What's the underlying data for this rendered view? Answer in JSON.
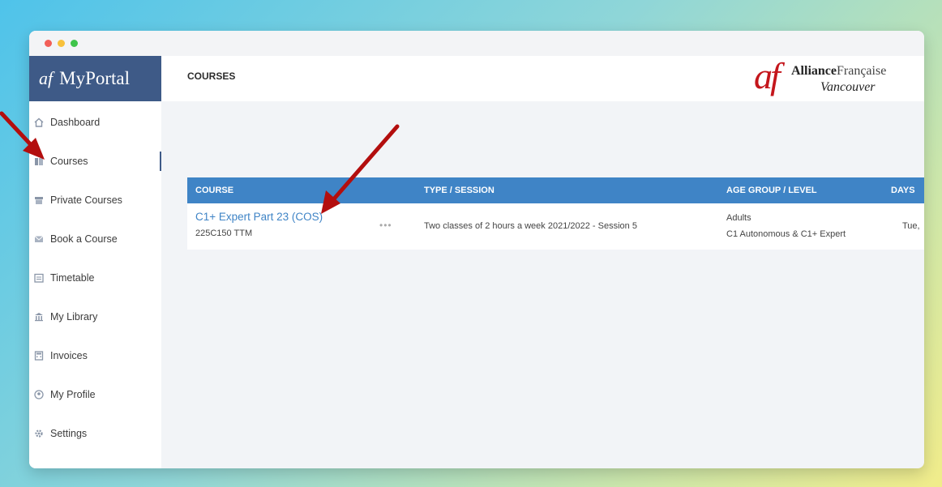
{
  "sidebar": {
    "brand_mark": "af",
    "brand_name": "MyPortal",
    "items": [
      {
        "label": "Dashboard",
        "icon": "home-icon"
      },
      {
        "label": "Courses",
        "icon": "book-icon",
        "active": true
      },
      {
        "label": "Private Courses",
        "icon": "archive-icon"
      },
      {
        "label": "Book a Course",
        "icon": "mail-icon"
      },
      {
        "label": "Timetable",
        "icon": "calendar-icon"
      },
      {
        "label": "My Library",
        "icon": "library-icon"
      },
      {
        "label": "Invoices",
        "icon": "calculator-icon"
      },
      {
        "label": "My Profile",
        "icon": "user-icon"
      },
      {
        "label": "Settings",
        "icon": "gear-icon"
      }
    ]
  },
  "header": {
    "title": "COURSES",
    "logo_mark": "af",
    "logo_line1_bold": "Alliance",
    "logo_line1_rest": "Française",
    "logo_line2": "Vancouver"
  },
  "table": {
    "columns": [
      "COURSE",
      "TYPE / SESSION",
      "AGE GROUP / LEVEL",
      "DAYS"
    ],
    "rows": [
      {
        "course_name": "C1+ Expert Part 23 (COS)",
        "course_code": "225C150 TTM",
        "more": "•••",
        "type_session": "Two classes of 2 hours a week 2021/2022 - Session 5",
        "age_group": "Adults",
        "level": "C1 Autonomous & C1+ Expert",
        "days": "Tue,"
      }
    ]
  },
  "colors": {
    "sidebar_brand_bg": "#3e5a87",
    "table_header_bg": "#3f84c6",
    "link": "#3f84c6",
    "annotation_arrow": "#b30e0e"
  }
}
